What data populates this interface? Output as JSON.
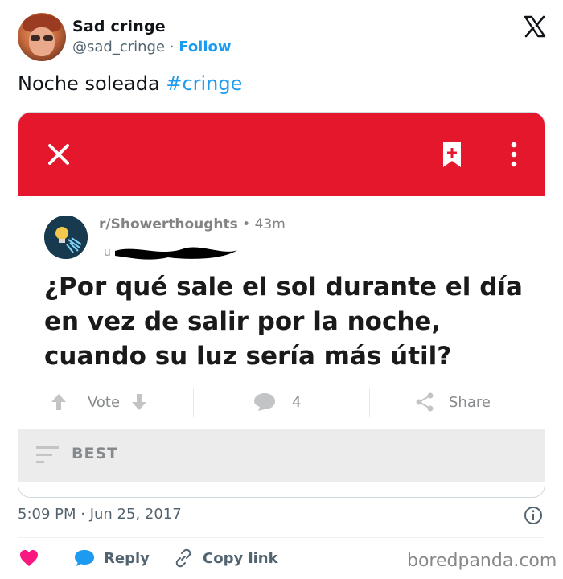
{
  "tweet": {
    "author_name": "Sad cringe",
    "author_handle": "@sad_cringe",
    "separator": "·",
    "follow_label": "Follow",
    "text_plain": "Noche soleada ",
    "text_hashtag": "#cringe",
    "timestamp": "5:09 PM · Jun 25, 2017"
  },
  "reddit_post": {
    "subreddit": "r/Showerthoughts",
    "age": "• 43m",
    "username_initial": "u",
    "title": "¿Por qué sale el sol durante el día en vez de salir por la noche, cuando su luz sería más útil?",
    "vote_label": "Vote",
    "comment_count": "4",
    "share_label": "Share",
    "sort_label": "BEST"
  },
  "footer": {
    "reply_label": "Reply",
    "copy_link_label": "Copy link"
  },
  "watermark": "boredpanda.com",
  "colors": {
    "reddit_red": "#e4172d",
    "twitter_blue": "#1d9bf0",
    "like_pink": "#f91880",
    "muted_gray": "#536471"
  },
  "icons": [
    "x-logo",
    "close-icon",
    "bookmark-icon",
    "more-icon",
    "upvote-icon",
    "downvote-icon",
    "comment-icon",
    "share-icon",
    "sort-icon",
    "info-icon",
    "heart-icon",
    "reply-icon",
    "link-icon"
  ]
}
